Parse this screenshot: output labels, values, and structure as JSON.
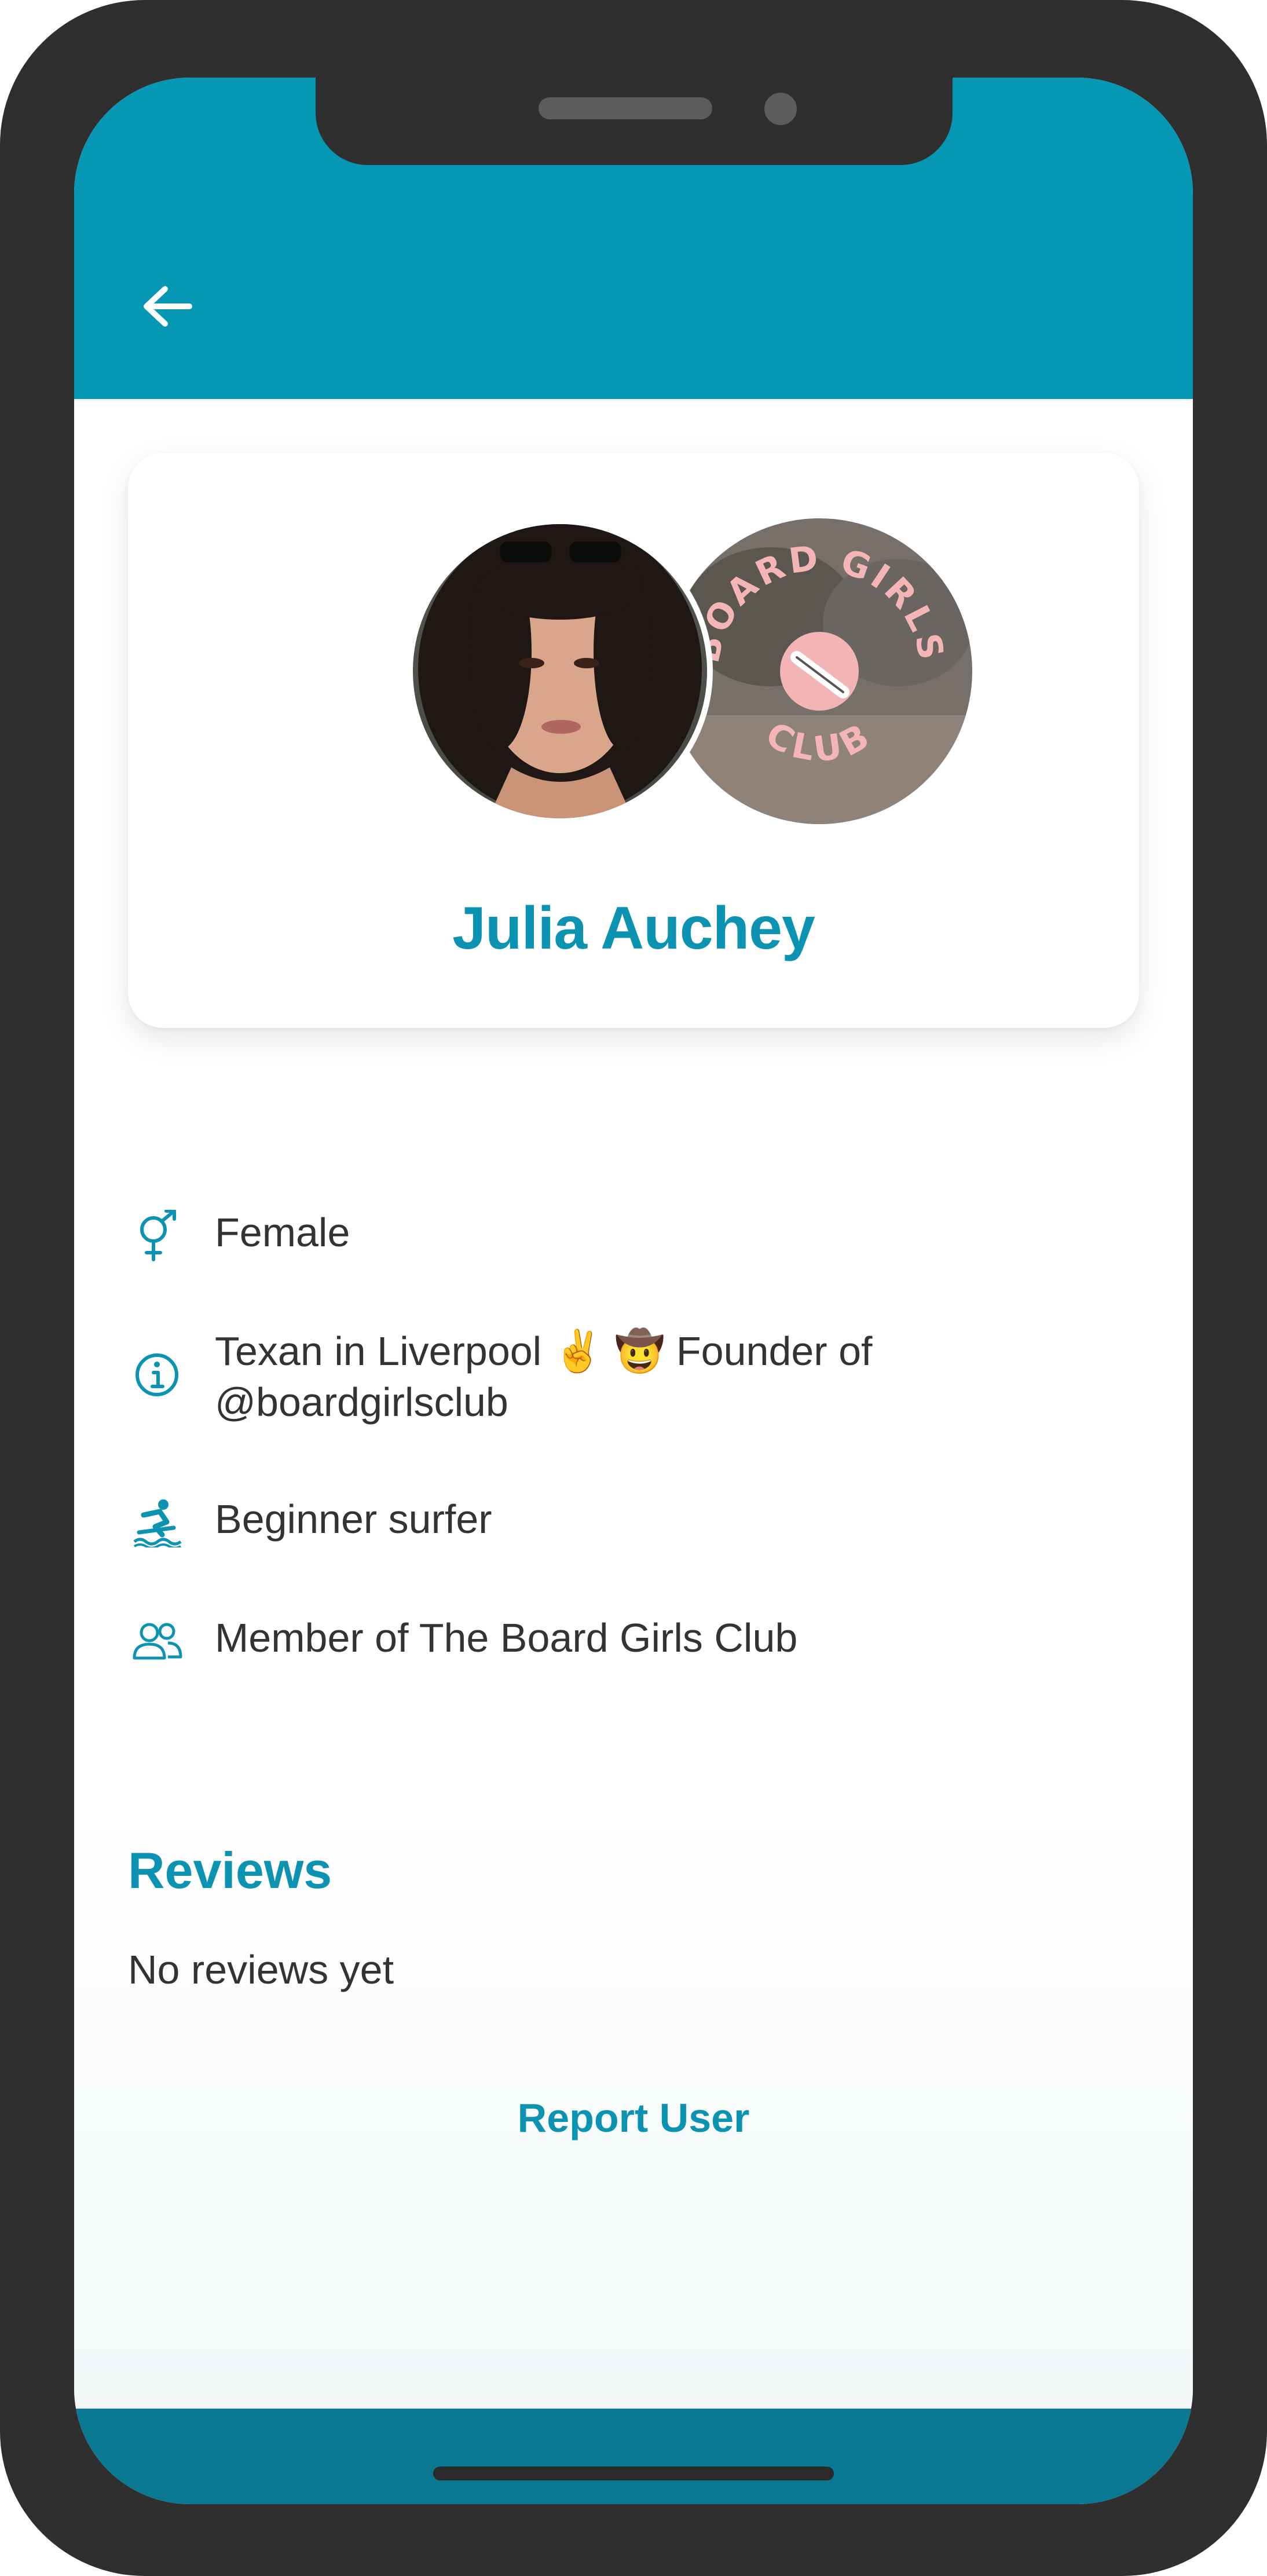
{
  "profile": {
    "name": "Julia Auchey",
    "club_logo_text": "BOARD GIRLS CLUB"
  },
  "details": [
    {
      "icon": "gender-icon",
      "text": "Female"
    },
    {
      "icon": "info-icon",
      "text": "Texan in Liverpool ✌️ 🤠 Founder of @boardgirlsclub"
    },
    {
      "icon": "surfer-icon",
      "text": "Beginner surfer"
    },
    {
      "icon": "group-icon",
      "text": "Member of The Board Girls Club"
    }
  ],
  "reviews": {
    "title": "Reviews",
    "empty_text": "No reviews yet"
  },
  "actions": {
    "report_label": "Report User"
  },
  "colors": {
    "header": "#0597b4",
    "accent": "#0b93b1",
    "bottom_bar": "#0a7891",
    "text": "#333333"
  }
}
